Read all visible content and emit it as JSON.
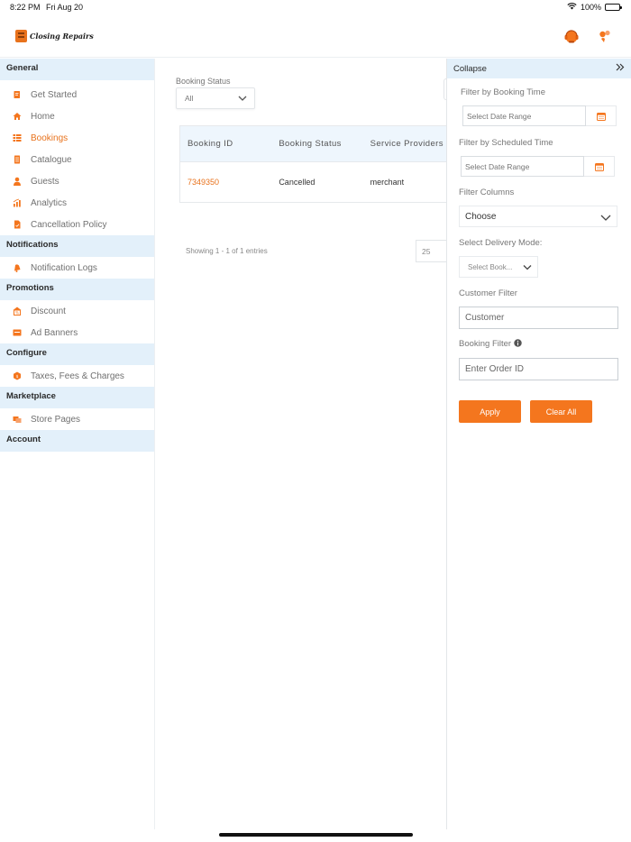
{
  "statusbar": {
    "time": "8:22 PM",
    "date": "Fri Aug 20",
    "battery": "100%"
  },
  "header": {
    "logo_text": "Closing Repairs"
  },
  "sidebar": {
    "sections": {
      "general": "General",
      "notifications": "Notifications",
      "promotions": "Promotions",
      "configure": "Configure",
      "marketplace": "Marketplace",
      "account": "Account"
    },
    "items": {
      "get_started": "Get Started",
      "home": "Home",
      "bookings": "Bookings",
      "catalogue": "Catalogue",
      "guests": "Guests",
      "analytics": "Analytics",
      "cancellation_policy": "Cancellation Policy",
      "notification_logs": "Notification Logs",
      "discount": "Discount",
      "ad_banners": "Ad Banners",
      "taxes": "Taxes, Fees & Charges",
      "store_pages": "Store Pages"
    },
    "active": "bookings"
  },
  "main": {
    "booking_status_label": "Booking Status",
    "booking_status_value": "All",
    "table": {
      "columns": [
        "Booking ID",
        "Booking Status",
        "Service Providers"
      ],
      "rows": [
        {
          "booking_id": "7349350",
          "status": "Cancelled",
          "provider": "merchant"
        }
      ]
    },
    "showing": "Showing 1 - 1 of 1 entries",
    "page_size": "25"
  },
  "panel": {
    "collapse": "Collapse",
    "booking_time_label": "Filter by Booking Time",
    "booking_time_placeholder": "Select Date Range",
    "scheduled_time_label": "Filter by Scheduled Time",
    "scheduled_time_placeholder": "Select Date Range",
    "filter_columns_label": "Filter Columns",
    "filter_columns_value": "Choose",
    "delivery_mode_label": "Select Delivery Mode:",
    "delivery_mode_value": "Select Book...",
    "customer_filter_label": "Customer Filter",
    "customer_placeholder": "Customer",
    "booking_filter_label": "Booking Filter",
    "order_placeholder": "Enter Order ID",
    "apply_label": "Apply",
    "clear_label": "Clear All"
  },
  "colors": {
    "accent": "#f4761e",
    "section_bg": "#e3f0fa",
    "link": "#e8721c"
  }
}
